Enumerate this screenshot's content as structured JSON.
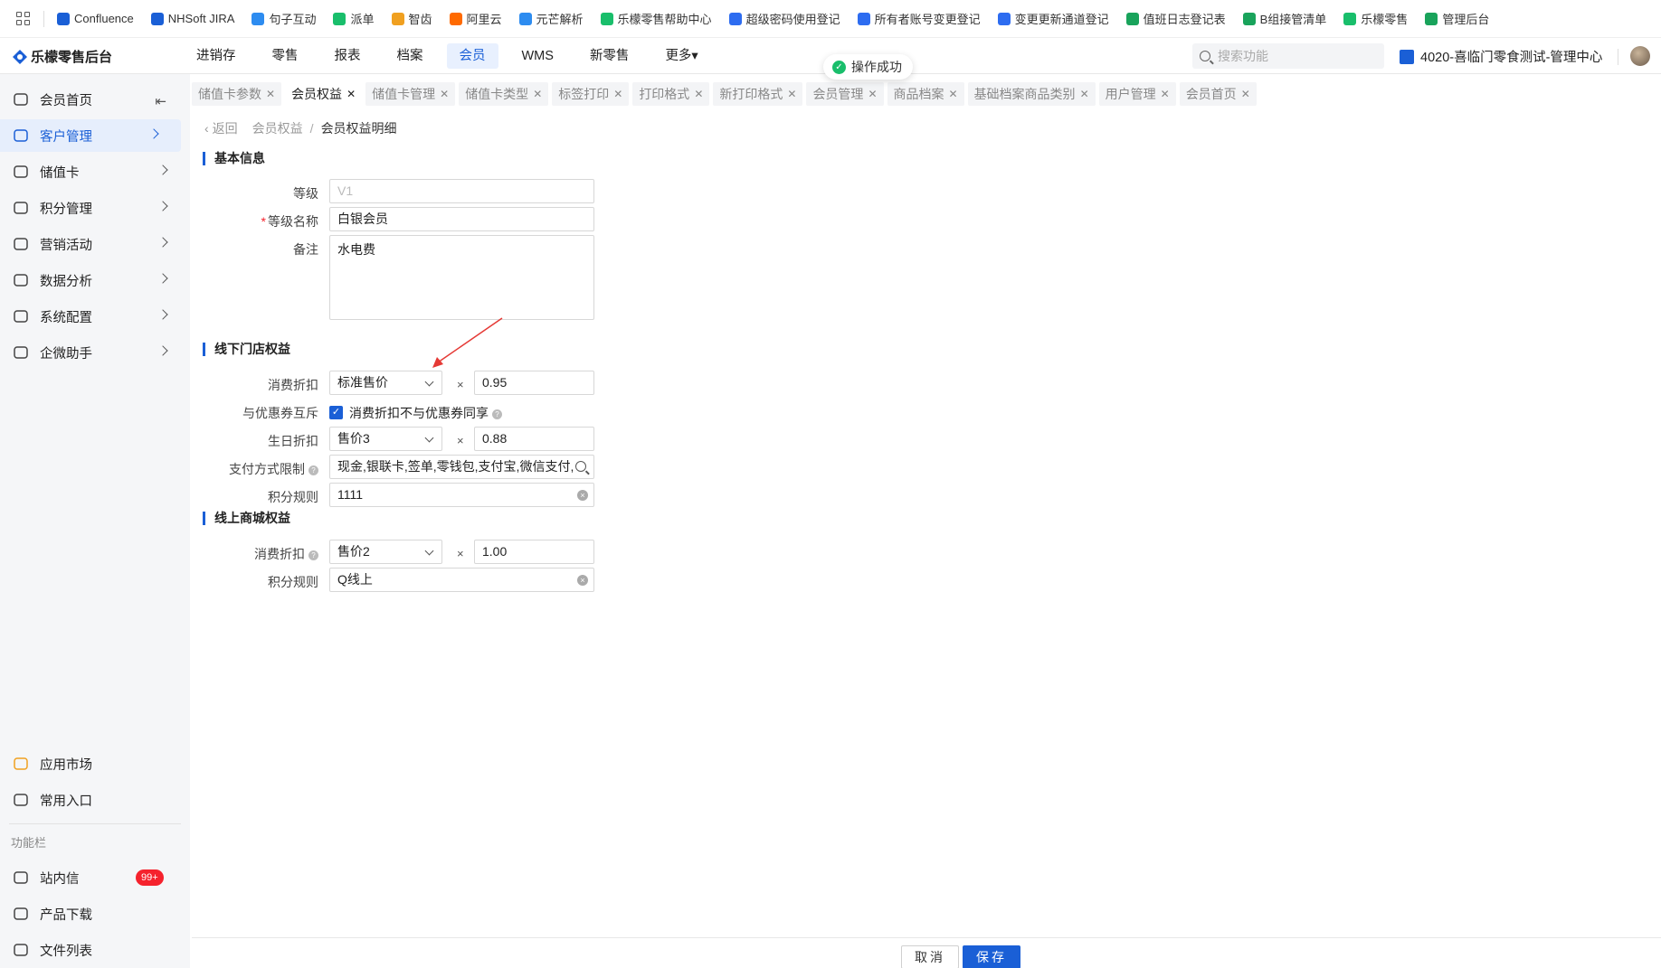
{
  "bookmarks": [
    {
      "label": "Confluence",
      "icon": "confluence-icon",
      "color": "#1a5fd6"
    },
    {
      "label": "NHSoft JIRA",
      "icon": "jira-icon",
      "color": "#1a5fd6"
    },
    {
      "label": "句子互动",
      "icon": "juzi-icon",
      "color": "#2d8cf0"
    },
    {
      "label": "派单",
      "icon": "paidan-icon",
      "color": "#19be6b"
    },
    {
      "label": "智齿",
      "icon": "zhichi-icon",
      "color": "#f0a020"
    },
    {
      "label": "阿里云",
      "icon": "aliyun-icon",
      "color": "#ff6a00"
    },
    {
      "label": "元芒解析",
      "icon": "yuanmang-icon",
      "color": "#2d8cf0"
    },
    {
      "label": "乐檬零售帮助中心",
      "icon": "lemeng-help-icon",
      "color": "#19be6b"
    },
    {
      "label": "超级密码使用登记",
      "icon": "doc-icon",
      "color": "#2d6cf0"
    },
    {
      "label": "所有者账号变更登记",
      "icon": "doc-icon",
      "color": "#2d6cf0"
    },
    {
      "label": "变更更新通道登记",
      "icon": "doc-icon",
      "color": "#2d6cf0"
    },
    {
      "label": "值班日志登记表",
      "icon": "sheet-icon",
      "color": "#19a35b"
    },
    {
      "label": "B组接管清单",
      "icon": "sheet-icon",
      "color": "#19a35b"
    },
    {
      "label": "乐檬零售",
      "icon": "lemeng-icon",
      "color": "#19be6b"
    },
    {
      "label": "管理后台",
      "icon": "admin-icon",
      "color": "#19a35b"
    }
  ],
  "header": {
    "logo": "乐檬零售后台",
    "nav": [
      "进销存",
      "零售",
      "报表",
      "档案",
      "会员",
      "WMS",
      "新零售",
      "更多▾"
    ],
    "active_nav": "会员",
    "search_placeholder": "搜索功能",
    "store": "4020-喜临门零食测试-管理中心",
    "toast": "操作成功"
  },
  "sidebar": {
    "items": [
      {
        "label": "会员首页",
        "icon": "home-icon"
      },
      {
        "label": "客户管理",
        "icon": "user-icon"
      },
      {
        "label": "储值卡",
        "icon": "card-icon"
      },
      {
        "label": "积分管理",
        "icon": "coins-icon"
      },
      {
        "label": "营销活动",
        "icon": "campaign-icon"
      },
      {
        "label": "数据分析",
        "icon": "chart-icon"
      },
      {
        "label": "系统配置",
        "icon": "settings-icon"
      },
      {
        "label": "企微助手",
        "icon": "chat-icon"
      }
    ],
    "bottom_items": [
      {
        "label": "应用市场",
        "icon": "app-market-icon"
      },
      {
        "label": "常用入口",
        "icon": "heart-icon"
      }
    ],
    "section": "功能栏",
    "tool_items": [
      {
        "label": "站内信",
        "icon": "mail-icon",
        "badge": "99+"
      },
      {
        "label": "产品下载",
        "icon": "download-icon"
      },
      {
        "label": "文件列表",
        "icon": "file-list-icon"
      }
    ]
  },
  "tabs": [
    "储值卡参数",
    "会员权益",
    "储值卡管理",
    "储值卡类型",
    "标签打印",
    "打印格式",
    "新打印格式",
    "会员管理",
    "商品档案",
    "基础档案商品类别",
    "用户管理",
    "会员首页"
  ],
  "active_tab": "会员权益",
  "breadcrumb": {
    "back": "返回",
    "parent": "会员权益",
    "current": "会员权益明细"
  },
  "basic": {
    "title": "基本信息",
    "level_label": "等级",
    "level_value": "V1",
    "name_label": "等级名称",
    "name_value": "白银会员",
    "remark_label": "备注",
    "remark_value": "水电费"
  },
  "offline": {
    "title": "线下门店权益",
    "discount_label": "消费折扣",
    "discount_select": "标准售价",
    "discount_value": "0.95",
    "exclusive_label": "与优惠券互斥",
    "exclusive_checkbox_label": "消费折扣不与优惠券同享",
    "exclusive_checked": true,
    "birthday_label": "生日折扣",
    "birthday_select": "售价3",
    "birthday_value": "0.88",
    "payment_label": "支付方式限制",
    "payment_value": "现金,银联卡,签单,零钱包,支付宝,微信支付,",
    "points_label": "积分规则",
    "points_value": "1111"
  },
  "online": {
    "title": "线上商城权益",
    "discount_label": "消费折扣",
    "discount_select": "售价2",
    "discount_value": "1.00",
    "points_label": "积分规则",
    "points_value": "Q线上"
  },
  "times_sign": "×",
  "buttons": {
    "cancel": "取消",
    "save": "保存"
  }
}
